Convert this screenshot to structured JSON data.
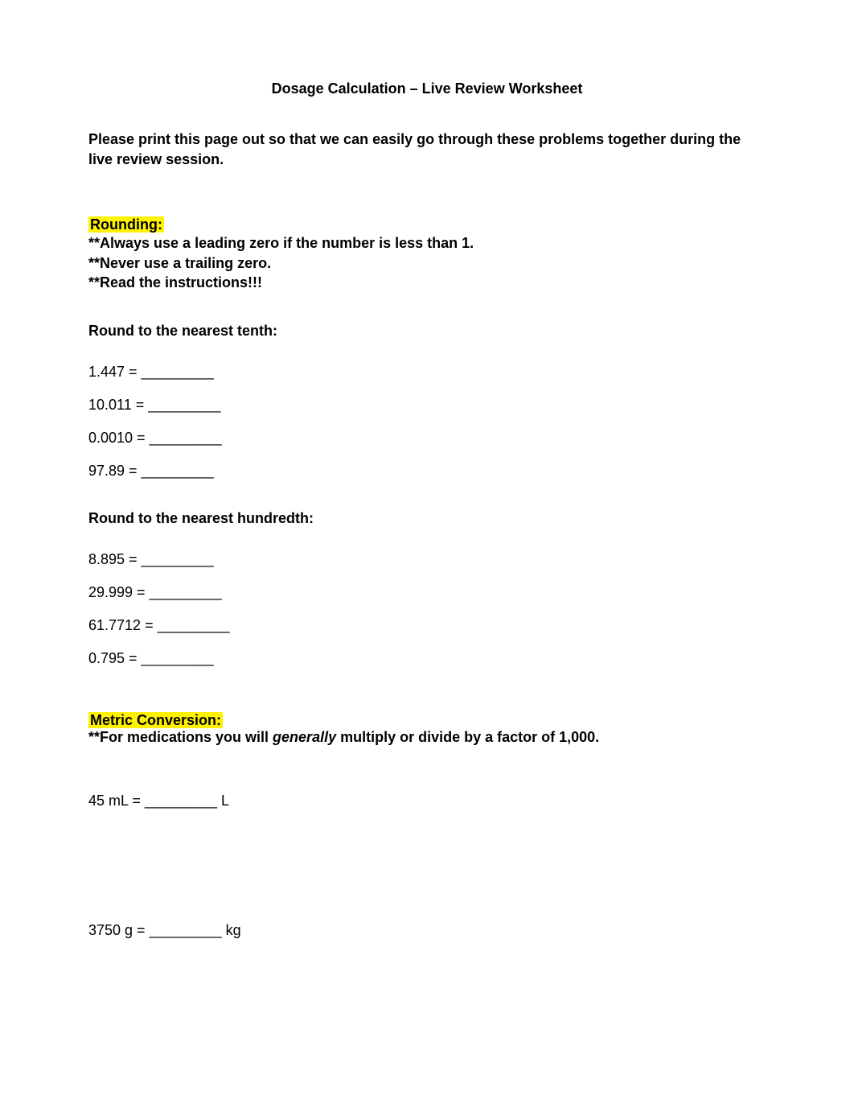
{
  "title": "Dosage Calculation – Live Review Worksheet",
  "intro": "Please print this page out so that we can easily go through these problems together during the live review session.",
  "rounding": {
    "heading": "Rounding:",
    "rules": [
      "**Always use a leading zero if the number is less than 1.",
      "**Never use a trailing zero.",
      "**Read the instructions!!!"
    ],
    "tenth_head": "Round to the nearest tenth:",
    "tenth_problems": [
      "1.447 = _________",
      "10.011 = _________",
      "0.0010 = _________",
      "97.89 = _________"
    ],
    "hundredth_head": "Round to the nearest hundredth:",
    "hundredth_problems": [
      "8.895 = _________",
      "29.999 = _________",
      "61.7712 = _________",
      "0.795 = _________"
    ]
  },
  "metric": {
    "heading": "Metric Conversion:",
    "rule_prefix": "**For medications you will ",
    "rule_italic": "generally",
    "rule_suffix": " multiply or divide by a factor of 1,000.",
    "conv1": "45 mL = _________ L",
    "conv2": "3750 g = _________ kg"
  }
}
